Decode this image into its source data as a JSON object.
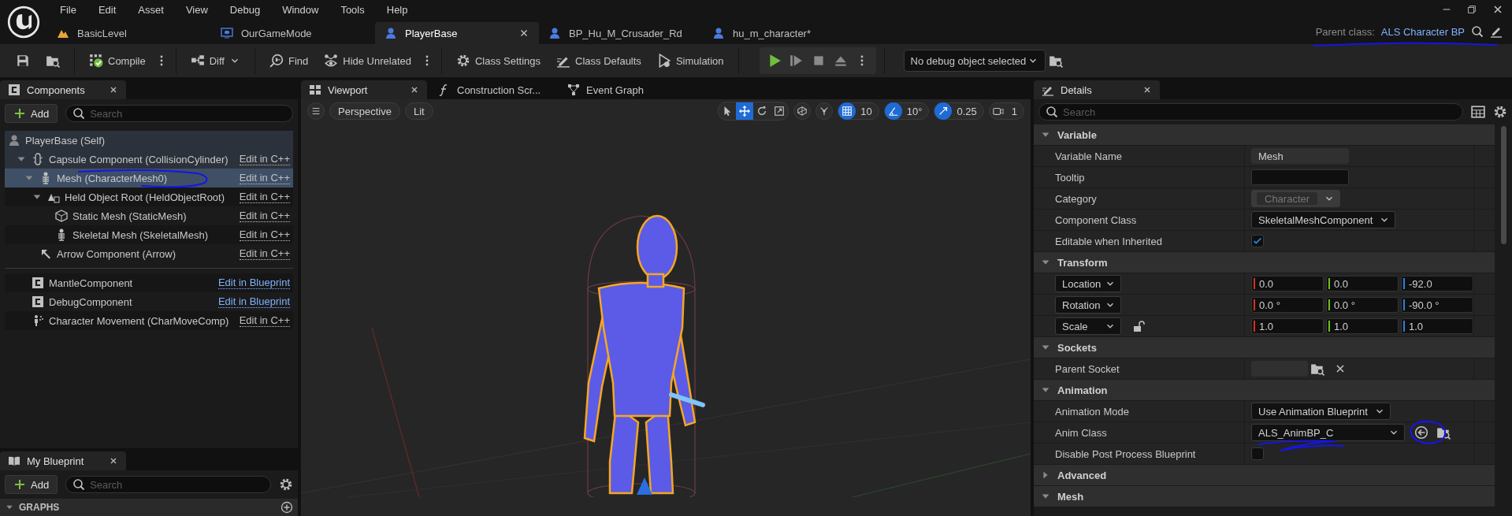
{
  "menu": [
    "File",
    "Edit",
    "Asset",
    "View",
    "Debug",
    "Window",
    "Tools",
    "Help"
  ],
  "document_tabs": [
    {
      "label": "BasicLevel",
      "kind": "level",
      "selected": false
    },
    {
      "label": "OurGameMode",
      "kind": "gamemode",
      "selected": false
    },
    {
      "label": "PlayerBase",
      "kind": "character",
      "selected": true
    },
    {
      "label": "BP_Hu_M_Crusader_Rd",
      "kind": "character",
      "selected": false
    },
    {
      "label": "hu_m_character*",
      "kind": "character",
      "selected": false
    }
  ],
  "parent_class": {
    "label": "Parent class:",
    "value": "ALS Character BP"
  },
  "toolbar": [
    {
      "kind": "save"
    },
    {
      "kind": "browse"
    },
    {
      "kind": "compile",
      "label": "Compile",
      "overflow_menu": true
    },
    {
      "kind": "diff",
      "label": "Diff",
      "dropdown": true
    },
    {
      "kind": "find",
      "label": "Find"
    },
    {
      "kind": "hide_unrelated",
      "label": "Hide Unrelated",
      "overflow_menu": true
    },
    {
      "kind": "class_settings",
      "label": "Class Settings"
    },
    {
      "kind": "class_defaults",
      "label": "Class Defaults"
    },
    {
      "kind": "simulation",
      "label": "Simulation"
    }
  ],
  "debug_filter": {
    "value": "No debug object selected"
  },
  "components_panel": {
    "tab": "Components",
    "add_label": "Add",
    "search_placeholder": "Search",
    "tree": [
      {
        "label": "PlayerBase (Self)",
        "kind": "self",
        "highlighted": true,
        "selected": false,
        "children": [
          {
            "label": "Capsule Component (CollisionCylinder)",
            "kind": "capsule",
            "link": "Edit in C++",
            "blueprint_link": false,
            "highlighted": true,
            "selected": false,
            "expanded": true,
            "children": [
              {
                "label": "Mesh (CharacterMesh0)",
                "kind": "skeletal",
                "link": "Edit in C++",
                "blueprint_link": false,
                "highlighted": false,
                "selected": true,
                "expanded": true,
                "children": [
                  {
                    "label": "Held Object Root (HeldObjectRoot)",
                    "kind": "held",
                    "link": "Edit in C++",
                    "blueprint_link": false,
                    "highlighted": false,
                    "selected": false,
                    "expanded": true,
                    "children": [
                      {
                        "label": "Static Mesh (StaticMesh)",
                        "kind": "static",
                        "link": "Edit in C++",
                        "blueprint_link": false,
                        "highlighted": false,
                        "selected": false
                      },
                      {
                        "label": "Skeletal Mesh (SkeletalMesh)",
                        "kind": "skeletal",
                        "link": "Edit in C++",
                        "blueprint_link": false,
                        "highlighted": false,
                        "selected": false
                      }
                    ]
                  }
                ]
              },
              {
                "label": "Arrow Component (Arrow)",
                "kind": "arrow",
                "link": "Edit in C++",
                "blueprint_link": false,
                "highlighted": false,
                "selected": false
              }
            ]
          }
        ]
      }
    ],
    "others": [
      {
        "label": "MantleComponent",
        "kind": "component",
        "link": "Edit in Blueprint",
        "blueprint_link": true,
        "selected": false
      },
      {
        "label": "DebugComponent",
        "kind": "component",
        "link": "Edit in Blueprint",
        "blueprint_link": true,
        "selected": false
      },
      {
        "label": "Character Movement (CharMoveComp)",
        "kind": "movement",
        "link": "Edit in C++",
        "blueprint_link": false,
        "selected": false
      }
    ]
  },
  "my_blueprint_panel": {
    "tab": "My Blueprint",
    "add_label": "Add",
    "search_placeholder": "Search",
    "sections": [
      {
        "title": "GRAPHS",
        "expanded": true
      }
    ]
  },
  "viewport_panel": {
    "tabs": [
      {
        "label": "Viewport",
        "kind": "viewport",
        "selected": true
      },
      {
        "label": "Construction Scr...",
        "kind": "function",
        "selected": false
      },
      {
        "label": "Event Graph",
        "kind": "graph",
        "selected": false
      }
    ],
    "view_mode": "Perspective",
    "lighting": "Lit",
    "tools": [
      {
        "kind": "select",
        "selected": false
      },
      {
        "kind": "translate",
        "selected": true
      },
      {
        "kind": "rotate",
        "selected": false
      },
      {
        "kind": "scale",
        "selected": false
      }
    ],
    "snaps": [
      {
        "kind": "grid",
        "on": true,
        "value": "10"
      },
      {
        "kind": "angle",
        "on": true,
        "value": "10°"
      },
      {
        "kind": "scale",
        "on": true,
        "value": "0.25"
      },
      {
        "kind": "camera_speed",
        "on": false,
        "value": "1"
      }
    ]
  },
  "details_panel": {
    "tab": "Details",
    "search_placeholder": "Search",
    "sections": [
      {
        "title": "Variable",
        "expanded": true,
        "rows": [
          {
            "label": "Variable Name",
            "kind": "text",
            "value": "Mesh",
            "read_only": true
          },
          {
            "label": "Tooltip",
            "kind": "text",
            "read_only": false
          },
          {
            "label": "Category",
            "kind": "dropdown",
            "value": "Character",
            "disabled": true
          },
          {
            "label": "Component Class",
            "kind": "dropdown",
            "value": "SkeletalMeshComponent",
            "disabled": false
          },
          {
            "label": "Editable when Inherited",
            "kind": "checkbox",
            "checked": true
          }
        ]
      },
      {
        "title": "Transform",
        "expanded": true,
        "rows": [
          {
            "mode": "Location",
            "kind": "vector",
            "values": [
              "0.0",
              "0.0",
              "-92.0"
            ],
            "lockable": false
          },
          {
            "mode": "Rotation",
            "kind": "vector",
            "values": [
              "0.0 °",
              "0.0 °",
              "-90.0 °"
            ],
            "lockable": false
          },
          {
            "mode": "Scale",
            "kind": "vector",
            "values": [
              "1.0",
              "1.0",
              "1.0"
            ],
            "lockable": true
          }
        ]
      },
      {
        "title": "Sockets",
        "expanded": true,
        "rows": [
          {
            "label": "Parent Socket",
            "kind": "socket"
          }
        ]
      },
      {
        "title": "Animation",
        "expanded": true,
        "rows": [
          {
            "label": "Animation Mode",
            "kind": "dropdown",
            "value": "Use Animation Blueprint",
            "disabled": false
          },
          {
            "label": "Anim Class",
            "kind": "class_picker",
            "value": "ALS_AnimBP_C"
          },
          {
            "label": "Disable Post Process Blueprint",
            "kind": "checkbox",
            "checked": false
          }
        ]
      },
      {
        "title": "Advanced",
        "expanded": false
      },
      {
        "title": "Mesh",
        "expanded": true
      }
    ]
  }
}
